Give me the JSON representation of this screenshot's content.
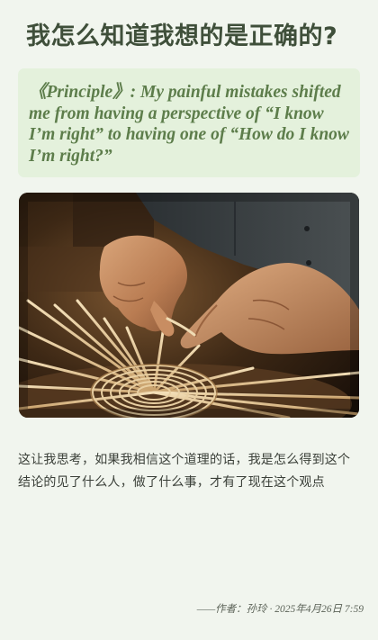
{
  "article": {
    "title": "我怎么知道我想的是正确的?",
    "quote": "《Principle》: My painful mistakes shifted me from having a perspective of “I know I’m right” to having one of “How do I know I’m right?”",
    "image": {
      "subject": "weaving-hands-photo"
    },
    "body": "这让我思考，如果我相信这个道理的话，我是怎么得到这个结论的见了什么人，做了什么事，才有了现在这个观点",
    "footer": "——作者：孙玲 · 2025年4月26日 7:59"
  },
  "colors": {
    "background": "#f1f5ee",
    "title": "#3f4f3a",
    "quote_bg": "#e4f1dc",
    "quote_text": "#5d7d4b",
    "body_text": "#3a3f38"
  }
}
